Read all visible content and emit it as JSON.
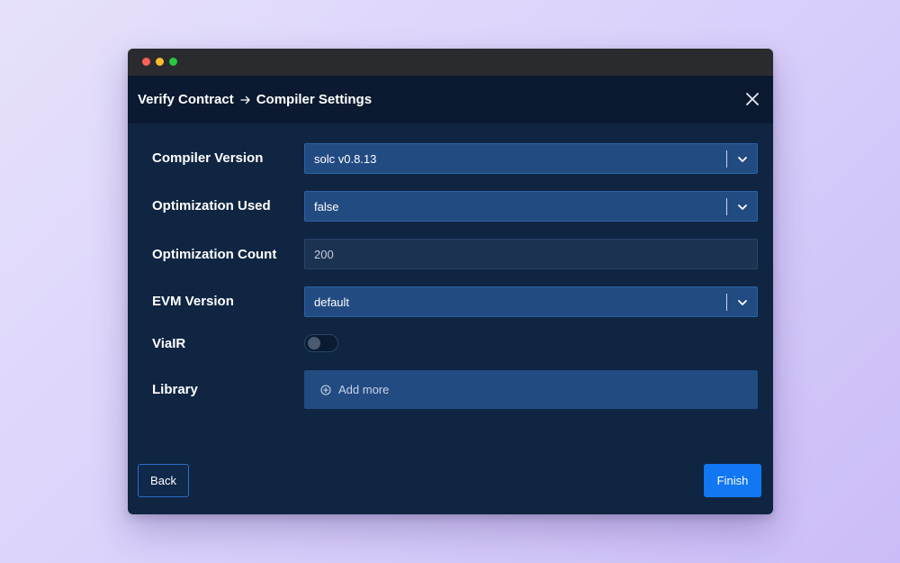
{
  "window": {
    "controls": [
      "close",
      "minimize",
      "maximize"
    ]
  },
  "header": {
    "breadcrumb_parent": "Verify Contract",
    "breadcrumb_current": "Compiler Settings",
    "arrow_icon": "arrow-right-icon",
    "close_icon": "close-icon"
  },
  "form": {
    "compiler_version": {
      "label": "Compiler Version",
      "value": "solc v0.8.13"
    },
    "optimization_used": {
      "label": "Optimization Used",
      "value": "false"
    },
    "optimization_count": {
      "label": "Optimization Count",
      "value": "200"
    },
    "evm_version": {
      "label": "EVM Version",
      "value": "default"
    },
    "via_ir": {
      "label": "ViaIR",
      "enabled": false
    },
    "library": {
      "label": "Library",
      "add_label": "Add more",
      "add_icon": "plus-circle-icon"
    }
  },
  "footer": {
    "back_label": "Back",
    "finish_label": "Finish"
  },
  "colors": {
    "background": "#0f2542",
    "header": "#0b1a30",
    "select": "#224b82",
    "primary": "#1177f3"
  }
}
